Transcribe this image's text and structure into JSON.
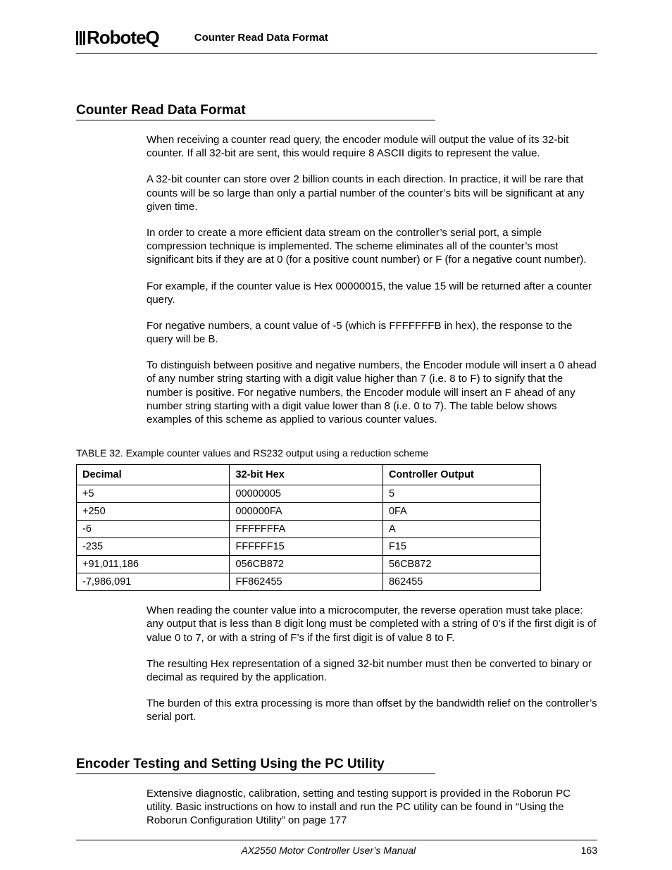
{
  "header": {
    "logo_text": "RoboteQ",
    "running_title": "Counter Read Data Format"
  },
  "section1": {
    "title": "Counter Read Data Format",
    "p1": "When receiving a counter read query, the encoder module will output the value of its 32-bit counter. If all 32-bit are sent, this would require 8 ASCII digits to represent the value.",
    "p2": "A 32-bit counter can store over 2 billion counts in each direction. In practice, it will be rare that counts will be so large than only a partial number of the counter’s bits will be significant at any given time.",
    "p3": "In order to create a more efficient data stream on the controller’s serial port, a simple compression technique is implemented. The scheme eliminates all of the counter’s most significant bits if they are at 0 (for a positive count number) or F (for a negative count number).",
    "p4": "For example, if the counter value is Hex 00000015, the value 15 will be returned after a counter query.",
    "p5": "For negative numbers, a count value of -5 (which is FFFFFFFB in hex), the response to the query will be B.",
    "p6": "To distinguish between positive and negative numbers, the Encoder module will insert a 0 ahead of any number string starting with a digit value higher than 7 (i.e. 8 to F) to signify that the number is positive. For negative numbers, the Encoder module will insert an F ahead of any number string starting with a digit value lower than 8 (i.e. 0 to 7). The table below shows examples of this scheme as applied to various counter values."
  },
  "table": {
    "caption_label": "TABLE 32. ",
    "caption_text": "Example counter values and RS232 output using a reduction scheme",
    "headers": {
      "c1": "Decimal",
      "c2": "32-bit Hex",
      "c3": "Controller Output"
    },
    "rows": [
      {
        "c1": "+5",
        "c2": "00000005",
        "c3": "5"
      },
      {
        "c1": "+250",
        "c2": "000000FA",
        "c3": "0FA"
      },
      {
        "c1": "-6",
        "c2": "FFFFFFFA",
        "c3": "A"
      },
      {
        "c1": "-235",
        "c2": "FFFFFF15",
        "c3": "F15"
      },
      {
        "c1": "+91,011,186",
        "c2": "056CB872",
        "c3": "56CB872"
      },
      {
        "c1": "-7,986,091",
        "c2": "FF862455",
        "c3": "862455"
      }
    ]
  },
  "after_table": {
    "p1": "When reading the counter value into a microcomputer, the reverse operation must take place: any output that is less than 8 digit long must be completed with a string of 0’s if the first digit is of value 0 to 7, or with a string of F’s if the first digit is of value 8 to F.",
    "p2": "The resulting Hex representation of a signed 32-bit number must then be converted to binary or decimal as required by the application.",
    "p3": "The burden of this extra processing is more than offset by the bandwidth relief on the controller’s serial port."
  },
  "section2": {
    "title": "Encoder Testing and Setting Using the PC Utility",
    "p1": "Extensive diagnostic, calibration, setting and testing support is provided in the Roborun PC utility. Basic instructions on how to install and run the PC utility can be found in “Using the Roborun Configuration Utility” on page 177"
  },
  "footer": {
    "doc_title": "AX2550 Motor Controller User’s Manual",
    "page_number": "163"
  }
}
